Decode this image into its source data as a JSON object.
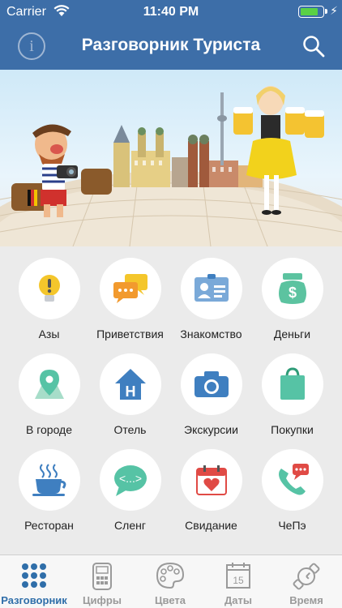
{
  "status_bar": {
    "carrier": "Carrier",
    "time": "11:40 PM",
    "battery_level": 0.85
  },
  "nav": {
    "title": "Разговорник Туриста",
    "info_icon": "info-icon",
    "search_icon": "search-icon"
  },
  "colors": {
    "nav_bg": "#3d6ea8",
    "accent": "#2f6ea9",
    "tile_icon_teal": "#56c3a5",
    "tile_icon_blue": "#3f7fc0",
    "tile_icon_red": "#e04a45",
    "tile_icon_yellow": "#f4c62b"
  },
  "categories": [
    {
      "label": "Азы",
      "icon": "lightbulb-icon"
    },
    {
      "label": "Приветствия",
      "icon": "speech-bubbles-icon"
    },
    {
      "label": "Знакомство",
      "icon": "id-card-icon"
    },
    {
      "label": "Деньги",
      "icon": "money-bag-icon"
    },
    {
      "label": "В городе",
      "icon": "map-pin-icon"
    },
    {
      "label": "Отель",
      "icon": "hotel-icon"
    },
    {
      "label": "Экскурсии",
      "icon": "camera-icon"
    },
    {
      "label": "Покупки",
      "icon": "shopping-bag-icon"
    },
    {
      "label": "Ресторан",
      "icon": "coffee-cup-icon"
    },
    {
      "label": "Сленг",
      "icon": "slang-bubble-icon"
    },
    {
      "label": "Свидание",
      "icon": "calendar-heart-icon"
    },
    {
      "label": "ЧеПэ",
      "icon": "phone-alert-icon"
    }
  ],
  "tabs": [
    {
      "label": "Разговорник",
      "icon": "grid-dots-icon",
      "active": true
    },
    {
      "label": "Цифры",
      "icon": "calculator-icon",
      "active": false
    },
    {
      "label": "Цвета",
      "icon": "palette-icon",
      "active": false
    },
    {
      "label": "Даты",
      "icon": "calendar-icon",
      "active": false,
      "day": "15"
    },
    {
      "label": "Время",
      "icon": "watch-icon",
      "active": false
    }
  ]
}
